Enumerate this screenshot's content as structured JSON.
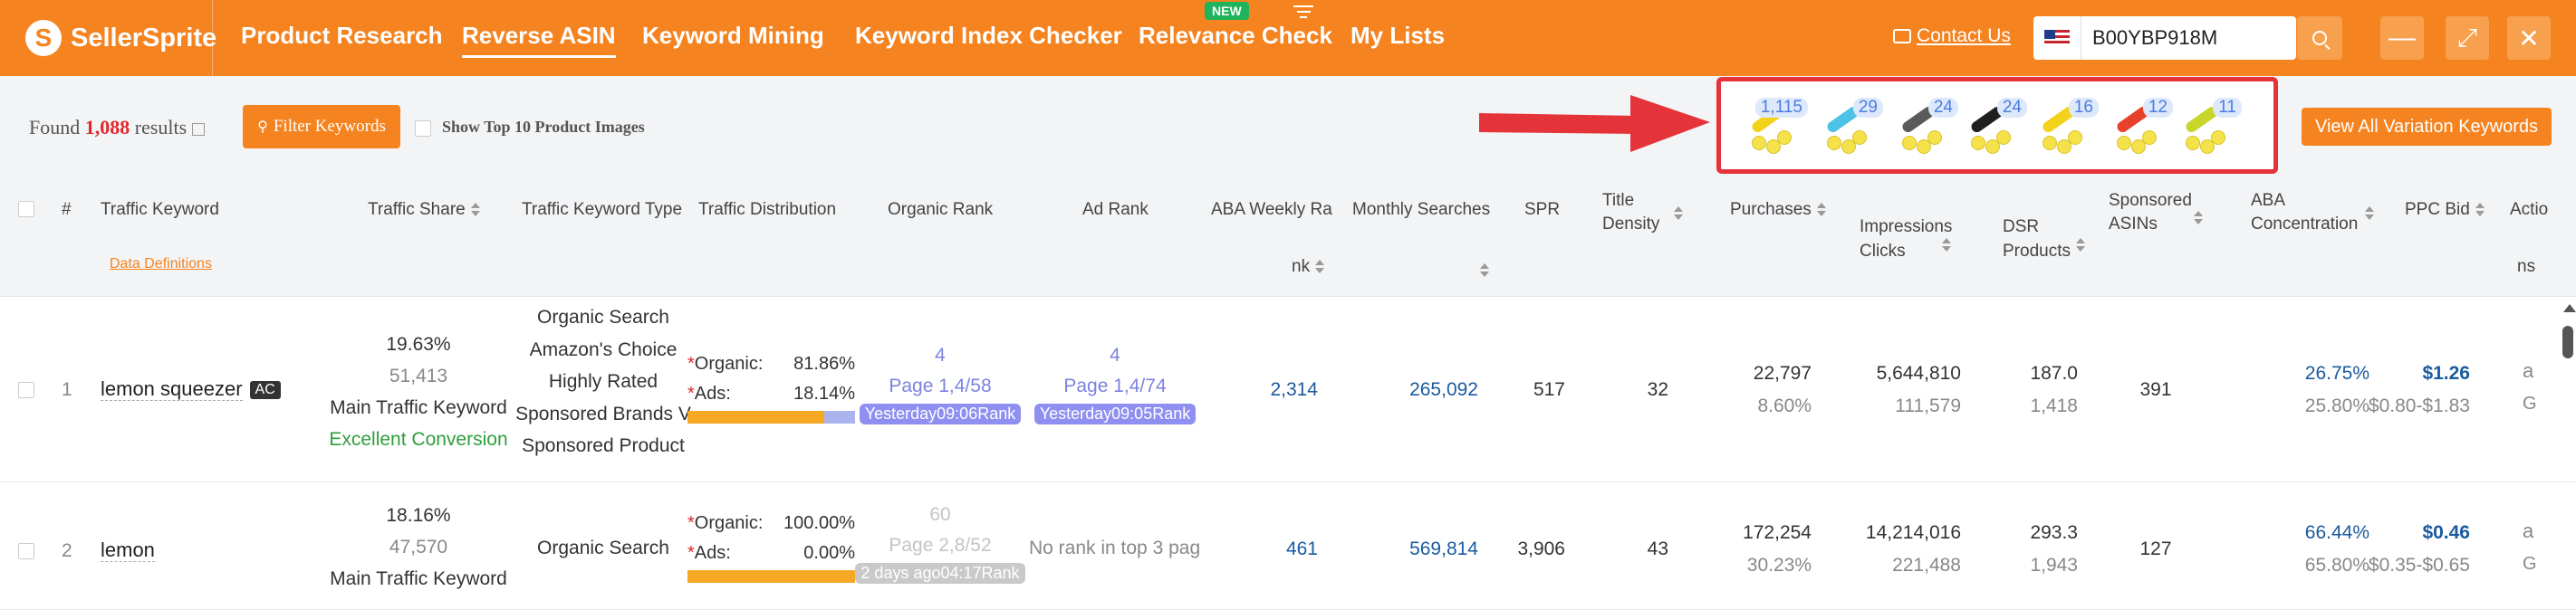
{
  "brand": {
    "name": "SellerSprite",
    "logo_letter": "S"
  },
  "nav": {
    "items": [
      {
        "label": "Product Research"
      },
      {
        "label": "Reverse ASIN"
      },
      {
        "label": "Keyword Mining"
      },
      {
        "label": "Keyword Index Checker"
      },
      {
        "label": "Relevance Check"
      },
      {
        "label": "My Lists"
      }
    ],
    "new_badge": "NEW",
    "contact": "Contact Us"
  },
  "search": {
    "value": "B00YBP918M"
  },
  "window": {
    "minimize": "—",
    "maximize": "⤢",
    "close": "✕"
  },
  "summary": {
    "found_prefix": "Found",
    "count": "1,088",
    "found_suffix": "results",
    "filter_label": "Filter Keywords",
    "top10_label": "Show Top 10 Product Images"
  },
  "variations": {
    "counts": [
      "1,115",
      "29",
      "24",
      "24",
      "16",
      "12",
      "11"
    ],
    "colors": [
      "#f2d21a",
      "#4cc3e6",
      "#5a5a5a",
      "#1f1f1f",
      "#f2d21a",
      "#e8412b",
      "#c8d62a"
    ],
    "view_all": "View All Variation Keywords"
  },
  "table": {
    "headers": {
      "index": "#",
      "keyword": "Traffic Keyword",
      "data_def": "Data Definitions",
      "share": "Traffic Share",
      "type": "Traffic Keyword Type",
      "dist": "Traffic Distribution",
      "organic_rank": "Organic Rank",
      "ad_rank": "Ad Rank",
      "aba_1": "ABA Weekly Ra",
      "aba_2": "nk",
      "monthly": "Monthly Searches",
      "spr": "SPR",
      "title_1": "Title",
      "title_2": "Density",
      "purchases": "Purchases",
      "impr_1": "Impressions",
      "impr_2": "Clicks",
      "dsr_1": "DSR",
      "dsr_2": "Products",
      "spons_1": "Sponsored",
      "spons_2": "ASINs",
      "abac_1": "ABA",
      "abac_2": "Concentration",
      "ppc": "PPC Bid",
      "actions_1": "Actio",
      "actions_2": "ns"
    },
    "rows": [
      {
        "index": "1",
        "keyword": "lemon squeezer",
        "ac": "AC",
        "share_pct": "19.63%",
        "share_val": "51,413",
        "share_tag": "Main Traffic Keyword",
        "share_tag2": "Excellent Conversion",
        "types": [
          "Organic Search",
          "Amazon's Choice",
          "Highly Rated",
          "Sponsored Brands V",
          "Sponsored Product"
        ],
        "organic_label": "Organic:",
        "organic_pct": "81.86%",
        "ads_label": "Ads:",
        "ads_pct": "18.14%",
        "organic_fraction": 0.8186,
        "org_rank": "4",
        "org_page": "Page 1,4/58",
        "org_time": "Yesterday09:06Rank",
        "ad_rank": "4",
        "ad_page": "Page 1,4/74",
        "ad_time": "Yesterday09:05Rank",
        "aba": "2,314",
        "monthly": "265,092",
        "spr": "517",
        "title": "32",
        "purchases": "22,797",
        "purchase_rate": "8.60%",
        "impressions": "5,644,810",
        "clicks": "111,579",
        "dsr": "187.0",
        "products": "1,418",
        "sponsored": "391",
        "aba_c": "26.75%",
        "aba_c2": "25.80%",
        "ppc": "$1.26",
        "ppc_range": "$0.80-$1.83"
      },
      {
        "index": "2",
        "keyword": "lemon",
        "share_pct": "18.16%",
        "share_val": "47,570",
        "share_tag": "Main Traffic Keyword",
        "types": [
          "Organic Search"
        ],
        "organic_label": "Organic:",
        "organic_pct": "100.00%",
        "ads_label": "Ads:",
        "ads_pct": "0.00%",
        "organic_fraction": 1.0,
        "org_rank": "60",
        "org_page": "Page 2,8/52",
        "org_time": "2 days ago04:17Rank",
        "ad_rank_text": "No rank in top 3 pag",
        "aba": "461",
        "monthly": "569,814",
        "spr": "3,906",
        "title": "43",
        "purchases": "172,254",
        "purchase_rate": "30.23%",
        "impressions": "14,214,016",
        "clicks": "221,488",
        "dsr": "293.3",
        "products": "1,943",
        "sponsored": "127",
        "aba_c": "66.44%",
        "aba_c2": "65.80%",
        "ppc": "$0.46",
        "ppc_range": "$0.35-$0.65"
      }
    ],
    "action_icons": [
      "amazon-icon",
      "google-icon"
    ]
  }
}
